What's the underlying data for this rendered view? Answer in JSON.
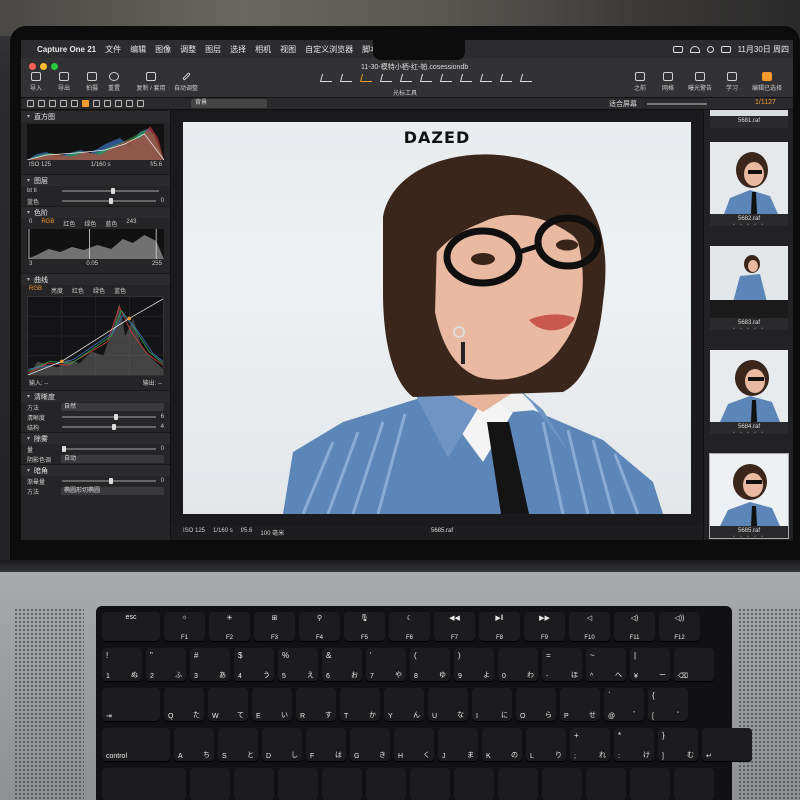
{
  "menubar": {
    "app": "Capture One 21",
    "items": [
      "文件",
      "编辑",
      "图像",
      "调整",
      "图层",
      "选择",
      "相机",
      "视图",
      "自定义浏览器",
      "脚本",
      "帮助"
    ],
    "clock": "11月30日 周四"
  },
  "toolbar": {
    "doc_title": "11-30-模特小栖-红-帕.cosessiondb",
    "left_buttons": [
      "导入",
      "导出",
      "拍摄",
      "重置",
      "复制 / 套用",
      "自动调整"
    ],
    "cursor_tools_label": "光标工具",
    "right_buttons": [
      "之前",
      "网格",
      "曝光警告",
      "学习",
      "编辑已选择"
    ]
  },
  "tabrow": {
    "background_select": "背景",
    "fit_label": "适合屏幕",
    "counter": "1/1127"
  },
  "leftpanel": {
    "histogram": {
      "title": "直方图",
      "iso": "ISO 125",
      "shutter": "1/160 s",
      "aperture": "f/5.6"
    },
    "layers": {
      "title": "图层",
      "sub_label": "bt ti",
      "row_label": "蓝色",
      "row_value": "0"
    },
    "levels": {
      "title": "色阶",
      "channels": [
        "RGB",
        "红色",
        "绿色",
        "蓝色"
      ],
      "left_value": "0",
      "right_value": "243",
      "out_left": "3",
      "out_mid": "0.05",
      "out_right": "255"
    },
    "curves": {
      "title": "曲线",
      "channels": [
        "RGB",
        "亮度",
        "红色",
        "绿色",
        "蓝色"
      ],
      "input_label": "输入: --",
      "output_label": "输出: --"
    },
    "clarity": {
      "title": "清晰度",
      "method_label": "方法",
      "method_value": "自然",
      "clarity_label": "清晰度",
      "clarity_value": "6",
      "structure_label": "结构",
      "structure_value": "4"
    },
    "dehaze": {
      "title": "除雾",
      "amount_label": "量",
      "amount_value": "0",
      "color_label": "阴影色调",
      "color_value": "自动"
    },
    "vignette": {
      "title": "暗角",
      "amount_label": "渐晕量",
      "amount_value": "0",
      "method_label": "方法",
      "method_value": "椭圆形切椭圆"
    }
  },
  "viewer": {
    "magazine_logo": "DAZED",
    "iso": "ISO 125",
    "shutter": "1/160 s",
    "aperture": "f/5.6",
    "focal": "100 毫米",
    "filename": "5685.raf"
  },
  "browser": {
    "thumbs": [
      {
        "name": "5681.raf"
      },
      {
        "name": "5682.raf"
      },
      {
        "name": "5683.raf"
      },
      {
        "name": "5684.raf"
      },
      {
        "name": "5685.raf"
      }
    ],
    "stars": "• • • • •"
  },
  "keyboard": {
    "function_row": [
      {
        "top": "esc",
        "bottom": ""
      },
      {
        "top": "☼",
        "bottom": "F1"
      },
      {
        "top": "☀",
        "bottom": "F2"
      },
      {
        "top": "⊞",
        "bottom": "F3"
      },
      {
        "top": "⚲",
        "bottom": "F4"
      },
      {
        "top": "🎙",
        "bottom": "F5"
      },
      {
        "top": "☾",
        "bottom": "F6"
      },
      {
        "top": "◀◀",
        "bottom": "F7"
      },
      {
        "top": "▶‖",
        "bottom": "F8"
      },
      {
        "top": "▶▶",
        "bottom": "F9"
      },
      {
        "top": "◁",
        "bottom": "F10"
      },
      {
        "top": "◁)",
        "bottom": "F11"
      },
      {
        "top": "◁))",
        "bottom": "F12"
      }
    ],
    "number_row": [
      {
        "t": "!",
        "b": "1",
        "r": "ぬ"
      },
      {
        "t": "\"",
        "b": "2",
        "r": "ふ"
      },
      {
        "t": "#",
        "b": "3",
        "r": "あ"
      },
      {
        "t": "$",
        "b": "4",
        "r": "う"
      },
      {
        "t": "%",
        "b": "5",
        "r": "え"
      },
      {
        "t": "&",
        "b": "6",
        "r": "お"
      },
      {
        "t": "'",
        "b": "7",
        "r": "や"
      },
      {
        "t": "(",
        "b": "8",
        "r": "ゆ"
      },
      {
        "t": ")",
        "b": "9",
        "r": "よ"
      },
      {
        "t": "",
        "b": "0",
        "r": "わ"
      },
      {
        "t": "=",
        "b": "-",
        "r": "ほ"
      },
      {
        "t": "~",
        "b": "^",
        "r": "へ"
      },
      {
        "t": "|",
        "b": "¥",
        "r": "ー"
      },
      {
        "t": "",
        "b": "⌫",
        "r": ""
      }
    ],
    "q_row": [
      {
        "t": "",
        "b": "⇥",
        "r": ""
      },
      {
        "t": "",
        "b": "Q",
        "r": "た"
      },
      {
        "t": "",
        "b": "W",
        "r": "て"
      },
      {
        "t": "",
        "b": "E",
        "r": "い"
      },
      {
        "t": "",
        "b": "R",
        "r": "す"
      },
      {
        "t": "",
        "b": "T",
        "r": "か"
      },
      {
        "t": "",
        "b": "Y",
        "r": "ん"
      },
      {
        "t": "",
        "b": "U",
        "r": "な"
      },
      {
        "t": "",
        "b": "I",
        "r": "に"
      },
      {
        "t": "",
        "b": "O",
        "r": "ら"
      },
      {
        "t": "",
        "b": "P",
        "r": "せ"
      },
      {
        "t": "`",
        "b": "@",
        "r": "゛"
      },
      {
        "t": "{",
        "b": "[",
        "r": "゜"
      }
    ],
    "a_row": [
      {
        "t": "",
        "b": "control",
        "r": ""
      },
      {
        "t": "",
        "b": "A",
        "r": "ち"
      },
      {
        "t": "",
        "b": "S",
        "r": "と"
      },
      {
        "t": "",
        "b": "D",
        "r": "し"
      },
      {
        "t": "",
        "b": "F",
        "r": "は"
      },
      {
        "t": "",
        "b": "G",
        "r": "き"
      },
      {
        "t": "",
        "b": "H",
        "r": "く"
      },
      {
        "t": "",
        "b": "J",
        "r": "ま"
      },
      {
        "t": "",
        "b": "K",
        "r": "の"
      },
      {
        "t": "",
        "b": "L",
        "r": "り"
      },
      {
        "t": "+",
        "b": ";",
        "r": "れ"
      },
      {
        "t": "*",
        "b": ":",
        "r": "け"
      },
      {
        "t": "}",
        "b": "]",
        "r": "む"
      },
      {
        "t": "",
        "b": "↵",
        "r": ""
      }
    ]
  },
  "colors": {
    "accent": "#f29a2e",
    "shirt_blue": "#5d86b8",
    "hair": "#3b261c"
  }
}
